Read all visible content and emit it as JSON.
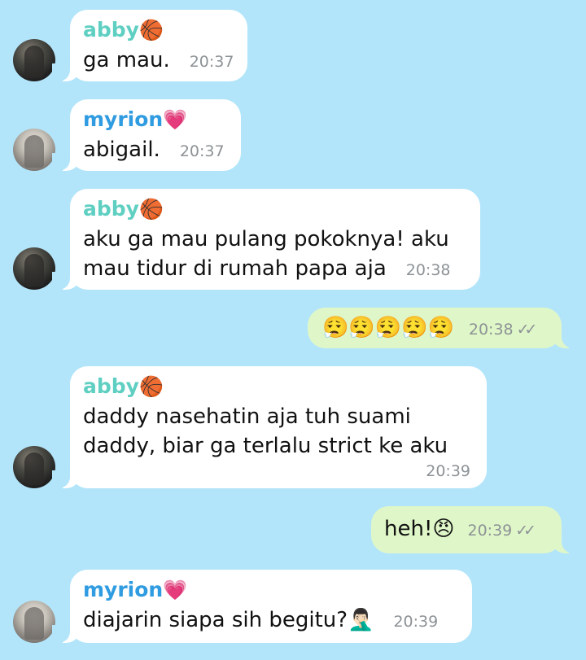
{
  "messages": [
    {
      "sender": "abby",
      "sender_emoji": "🏀",
      "lines": [
        "ga mau."
      ],
      "time": "20:37"
    },
    {
      "sender": "myrion",
      "sender_emoji": "💗",
      "lines": [
        "abigail."
      ],
      "time": "20:37"
    },
    {
      "sender": "abby",
      "sender_emoji": "🏀",
      "lines": [
        "aku ga mau pulang pokoknya! aku",
        "mau tidur di rumah papa aja"
      ],
      "time": "20:38"
    },
    {
      "outgoing": true,
      "text": "😮‍💨😮‍💨😮‍💨😮‍💨😮‍💨",
      "time": "20:38",
      "status_icon": "double-check-icon",
      "status": "✓✓"
    },
    {
      "sender": "abby",
      "sender_emoji": "🏀",
      "lines": [
        "daddy nasehatin aja tuh suami",
        "daddy, biar ga terlalu strict ke aku"
      ],
      "time": "20:39"
    },
    {
      "outgoing": true,
      "text": "heh!😠",
      "time": "20:39",
      "status_icon": "double-check-icon",
      "status": "✓✓"
    },
    {
      "sender": "myrion",
      "sender_emoji": "💗",
      "lines": [
        "diajarin siapa sih begitu?🤦🏻‍♂️"
      ],
      "time": "20:39"
    }
  ],
  "colors": {
    "background": "#b3e5fa",
    "incoming_bubble": "#ffffff",
    "outgoing_bubble": "#dff7c8",
    "abby_name": "#5fcfc2",
    "myrion_name": "#2f9be0"
  }
}
